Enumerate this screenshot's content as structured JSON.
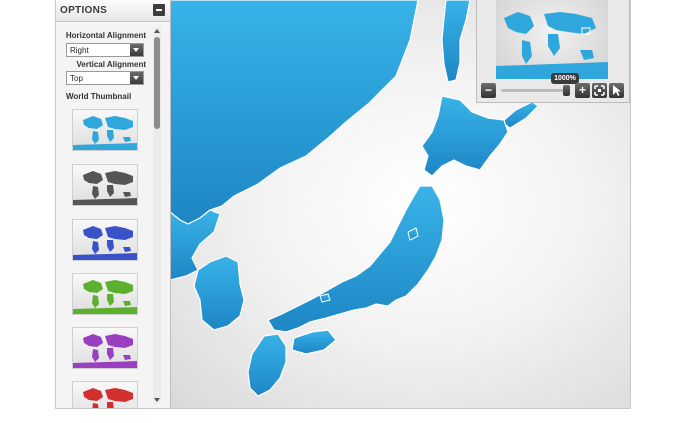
{
  "panel": {
    "title": "OPTIONS",
    "horizontal_alignment_label": "Horizontal Alignment",
    "horizontal_alignment_value": "Right",
    "vertical_alignment_label": "Vertical Alignment",
    "vertical_alignment_value": "Top",
    "world_thumbnail_label": "World Thumbnail",
    "thumbnails": [
      {
        "name": "blue",
        "color": "#2fa6dc"
      },
      {
        "name": "gray",
        "color": "#555555"
      },
      {
        "name": "indigo",
        "color": "#3a52c8"
      },
      {
        "name": "green",
        "color": "#5bb02e"
      },
      {
        "name": "purple",
        "color": "#9a3fc0"
      },
      {
        "name": "red",
        "color": "#d23030"
      }
    ]
  },
  "overview": {
    "zoom_level": "1000%",
    "buttons": [
      "zoom-out",
      "zoom-in",
      "fit-to-screen",
      "select-pointer"
    ]
  },
  "map": {
    "land_color": "#33aee4",
    "land_color_dark": "#1e86c6",
    "border_color": "#ffffff"
  }
}
